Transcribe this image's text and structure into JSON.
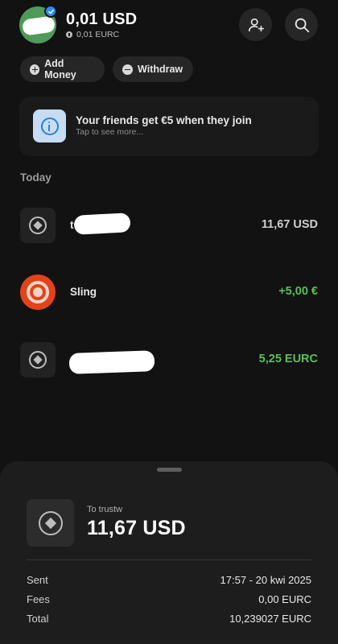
{
  "header": {
    "balance": "0,01 USD",
    "balance_secondary": "0,01 EURC"
  },
  "actions": {
    "add_money": "Add Money",
    "withdraw": "Withdraw"
  },
  "promo": {
    "title": "Your friends get €5 when they join",
    "subtitle": "Tap to see more..."
  },
  "transactions": {
    "section_label": "Today",
    "items": [
      {
        "name": "t",
        "amount": "11,67 USD",
        "icon": "token-icon",
        "name_redacted": true
      },
      {
        "name": "Sling",
        "amount": "+5,00 €",
        "icon": "sling-logo-icon",
        "amount_color": "#5cbf5c"
      },
      {
        "name": "",
        "amount": "5,25 EURC",
        "icon": "token-icon",
        "name_redacted": true,
        "amount_color": "#5cbf5c"
      }
    ]
  },
  "detail_sheet": {
    "label": "To trustw",
    "amount": "11,67 USD",
    "rows": [
      {
        "key": "Sent",
        "value": "17:57 - 20 kwi 2025"
      },
      {
        "key": "Fees",
        "value": "0,00 EURC"
      },
      {
        "key": "Total",
        "value": "10,239027 EURC"
      }
    ]
  },
  "colors": {
    "background": "#121212",
    "positive": "#5cbf5c",
    "verified_badge": "#2d8cf0",
    "sling_brand": "#e2431a"
  }
}
